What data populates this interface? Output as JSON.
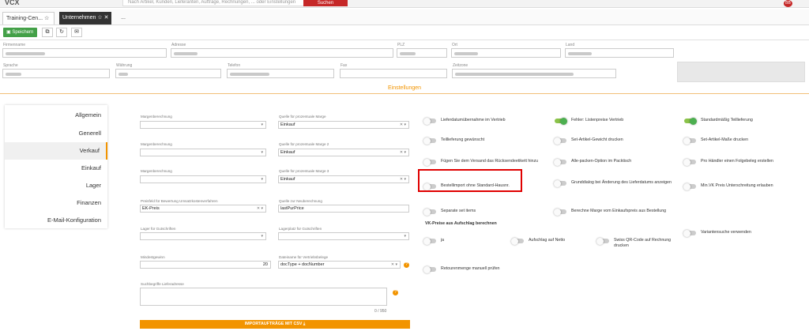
{
  "topbar": {
    "logo": "VCX",
    "search_placeholder": "Nach Artikel, Kunden, Lieferanten, Aufträge, Rechnungen, ... oder Einstellungen",
    "search_button": "Suchen",
    "avatar": "BB"
  },
  "tabs": [
    {
      "label": "Training-Cen..."
    },
    {
      "label": "Unternehmen"
    },
    {
      "label": "..."
    }
  ],
  "toolbar": {
    "save_label": "Speichern"
  },
  "header": {
    "labels": {
      "firmenname": "Firmenname",
      "adresse": "Adresse",
      "plz": "PLZ",
      "ort": "Ort",
      "land": "Land",
      "sprache": "Sprache",
      "waehrung": "Währung",
      "telefon": "Telefon",
      "fax": "Fax",
      "zeitzone": "Zeitzone"
    }
  },
  "section": {
    "title": "Einstellungen"
  },
  "nav": [
    {
      "label": "Allgemein"
    },
    {
      "label": "Generell"
    },
    {
      "label": "Verkauf"
    },
    {
      "label": "Einkauf"
    },
    {
      "label": "Lager"
    },
    {
      "label": "Finanzen"
    },
    {
      "label": "E-Mail-Konfiguration"
    }
  ],
  "form": {
    "mb1": "Margenberechnung",
    "q1": "Quelle für prozentuale Marge",
    "q1v": "Einkauf",
    "mb2": "Margenberechnung",
    "q2": "Quelle für prozentuale Marge 2",
    "q2v": "Einkauf",
    "mb3": "Margenberechnung",
    "q3": "Quelle für prozentuale Marge 3",
    "q3v": "Einkauf",
    "pf": "Preisfeld für Bewertung Umsatzkostenverfahren",
    "pfv": "EK-Preis",
    "qn": "Quelle zur Neuberechnung",
    "qnv": "lastPurPrice",
    "lg": "Lager für Gutschriften",
    "lp": "Lagerplatz für Gutschriften",
    "mg": "Mindestgewinn",
    "mgv": "20",
    "dn": "Dateiname für Vertriebsbelege",
    "dnv": "docType + docNumber",
    "sb": "Suchbegriffe Lieferadresse",
    "counter": "0 / 950",
    "import_btn": "IMPORTAUFTRÄGE MIT CSV  ⤓"
  },
  "toggles": {
    "c1": [
      "Lieferdatumübernahme im Vertrieb",
      "Teillieferung gewünscht",
      "Fügen Sie dem Versand das Rücksendeetikett hinzu",
      "Bestellimport ohne Standard-Hausnr.",
      "Separate set items"
    ],
    "c2": [
      "Fehler: Listenpreise Vertrieb",
      "Set-Artikel-Gewicht drucken",
      "Alle-packen-Option im Packtisch",
      "Grunddialog bei Änderung des Lieferdatums anzeigen",
      "Berechne Marge vom Einkaufspreis aus Bestellung"
    ],
    "c3": [
      "Standardmäßig Teillieferung",
      "Set-Artikel-Maße drucken",
      "Pro Händler einen Folgebeleg erstellen",
      "Min.VK Preis Unterschreitung erlauben"
    ],
    "vk_head": "VK-Preise aus Aufschlag berechnen",
    "vk": [
      "ja",
      "Aufschlag auf Netto",
      "Swiss QR-Code auf Rechnung drucken",
      "Variantensuche verwenden",
      "Retourenmenge manuell prüfen"
    ],
    "on": [
      "Fehler: Listenpreise Vertrieb",
      "Standardmäßig Teillieferung"
    ]
  },
  "colors": {
    "accent": "#f29400",
    "save": "#43a047",
    "danger": "#c62828",
    "highlight": "#e00000"
  }
}
